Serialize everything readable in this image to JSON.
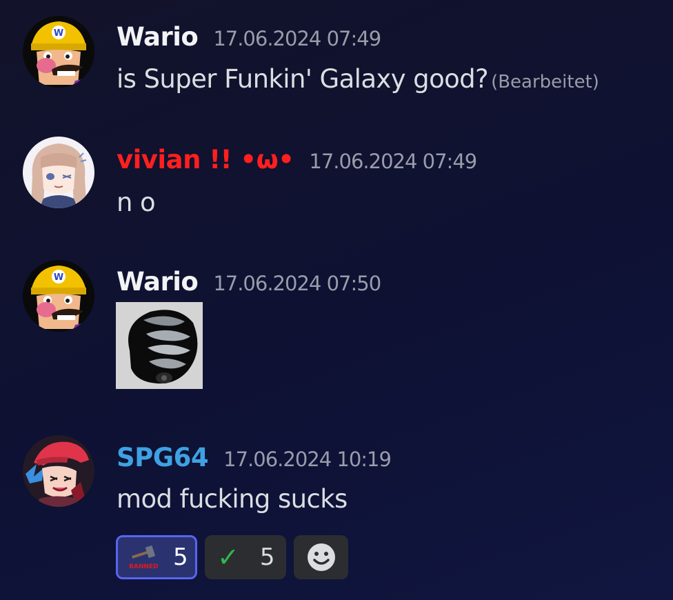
{
  "messages": [
    {
      "username": "Wario",
      "username_color": "#f2f3f5",
      "avatar": "wario-avatar",
      "timestamp": "17.06.2024 07:49",
      "text": "is Super Funkin' Galaxy good?",
      "edited_label": "(Bearbeitet)"
    },
    {
      "username": "vivian !! •ω•",
      "username_color": "#ff1f1f",
      "avatar": "vivian-avatar",
      "timestamp": "17.06.2024 07:49",
      "text": "n o"
    },
    {
      "username": "Wario",
      "username_color": "#f2f3f5",
      "avatar": "wario-avatar",
      "timestamp": "17.06.2024 07:50",
      "attachment": "shadow-creature-image"
    },
    {
      "username": "SPG64",
      "username_color": "#3fa1e3",
      "avatar": "spg64-avatar",
      "timestamp": "17.06.2024 10:19",
      "text": "mod fucking sucks",
      "reactions": [
        {
          "emoji": "banned-hammer-emoji",
          "emoji_text": "BANNED",
          "count": "5",
          "active": true
        },
        {
          "emoji": "check-mark-emoji",
          "emoji_text": "✓",
          "count": "5",
          "active": false
        },
        {
          "emoji": "add-reaction-icon",
          "count": "",
          "active": false
        }
      ]
    }
  ],
  "colors": {
    "background": "#0f1231",
    "text": "#dbdee1",
    "muted": "#9a9caa",
    "reaction_bg": "#2b2d31",
    "reaction_active_border": "#5865f2"
  }
}
